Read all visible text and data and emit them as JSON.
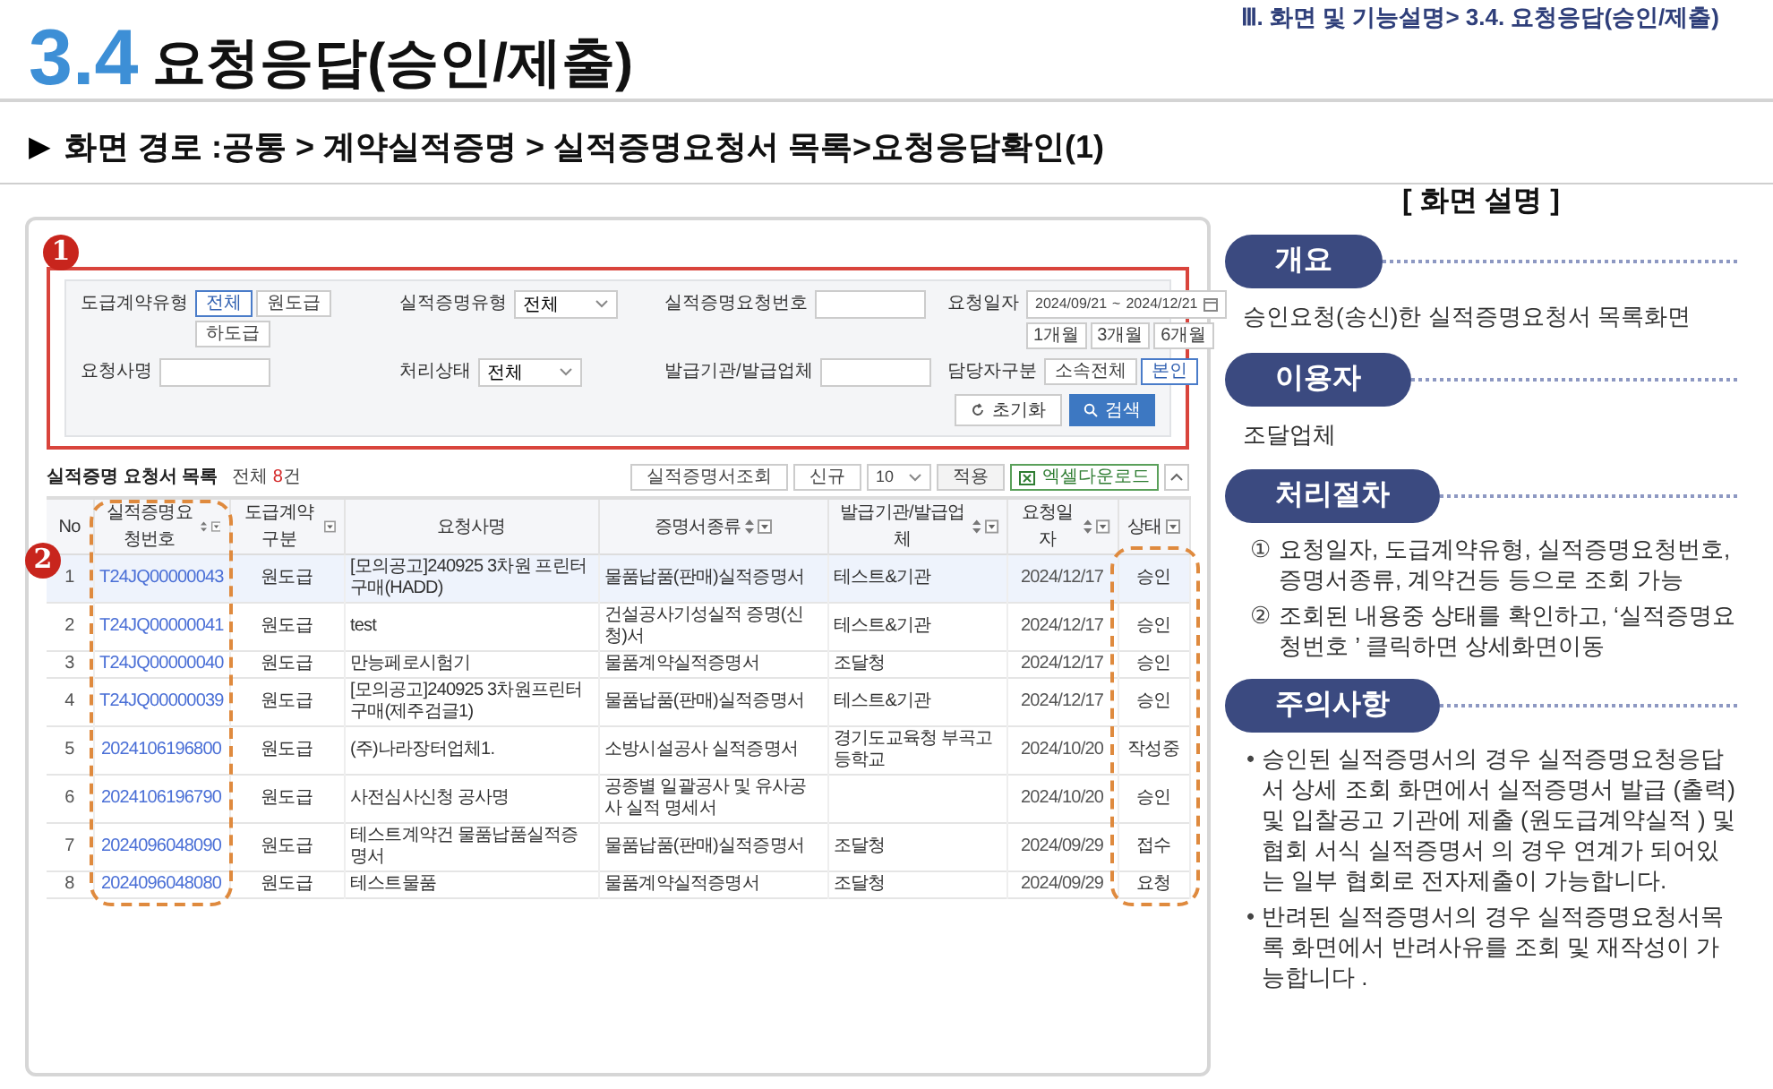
{
  "header": {
    "section_number": "3.4",
    "title": "요청응답(승인/제출)",
    "breadcrumb": "Ⅲ. 화면 및 기능설명> 3.4. 요청응답(승인/제출)"
  },
  "screen_path": {
    "marker": "▶",
    "text": "**화면 경로 :**공통 > 계약실적증명 > 실적증명요청서 목록>요청응답확인(1)"
  },
  "screen": {
    "callouts": [
      "1",
      "2"
    ],
    "filters": [
      {
        "kind": "toggle",
        "label": "도급계약유형",
        "options": [
          {
            "label": "전체",
            "selected": true
          },
          {
            "label": "원도급",
            "selected": false
          },
          {
            "label": "하도급",
            "selected": false
          }
        ]
      },
      {
        "kind": "select",
        "label": "실적증명유형",
        "value": "전체"
      },
      {
        "kind": "input",
        "label": "실적증명요청번호"
      },
      {
        "kind": "date_range",
        "label": "요청일자",
        "from": "2024/09/21",
        "separator": "~",
        "to": "2024/12/21",
        "presets": [
          "1개월",
          "3개월",
          "6개월"
        ]
      },
      {
        "kind": "input",
        "label": "요청사명"
      },
      {
        "kind": "select",
        "label": "처리상태",
        "value": "전체"
      },
      {
        "kind": "input",
        "label": "발급기관/발급업체"
      },
      {
        "kind": "toggle",
        "label": "담당자구분",
        "options": [
          {
            "label": "소속전체",
            "selected": false
          },
          {
            "label": "본인",
            "selected": true
          }
        ]
      }
    ],
    "filter_buttons": [
      {
        "kind": "reset",
        "label": "초기화"
      },
      {
        "kind": "search",
        "label": "검색"
      }
    ],
    "list": {
      "title": "실적증명 요청서 목록",
      "total_prefix": "전체 ",
      "total_count": "8",
      "total_suffix": "건",
      "toolbar": {
        "view_button": "실적증명서조회",
        "new_button": "신규",
        "page_size": "10",
        "apply_button": "적용",
        "excel_button": "엑셀다운로드"
      },
      "columns": [
        {
          "label": "No",
          "sortable": false,
          "filterable": false
        },
        {
          "label": "실적증명요청번호",
          "sortable": true,
          "filterable": true
        },
        {
          "label": "도급계약구분",
          "sortable": false,
          "filterable": true
        },
        {
          "label": "요청사명",
          "sortable": false,
          "filterable": false
        },
        {
          "label": "증명서종류",
          "sortable": true,
          "filterable": true
        },
        {
          "label": "발급기관/발급업체",
          "sortable": true,
          "filterable": true
        },
        {
          "label": "요청일자",
          "sortable": true,
          "filterable": true
        },
        {
          "label": "상태",
          "sortable": false,
          "filterable": true
        }
      ],
      "rows": [
        {
          "selected": true,
          "cells": [
            "1",
            "T24JQ00000043",
            "원도급",
            "[모의공고]240925 3차원 프린터 구매(HADD)",
            "물품납품(판매)실적증명서",
            "테스트&기관",
            "2024/12/17",
            "승인"
          ]
        },
        {
          "selected": false,
          "cells": [
            "2",
            "T24JQ00000041",
            "원도급",
            "test",
            "건설공사기성실적 증명(신청)서",
            "테스트&기관",
            "2024/12/17",
            "승인"
          ]
        },
        {
          "selected": false,
          "cells": [
            "3",
            "T24JQ00000040",
            "원도급",
            "만능페로시험기",
            "물품계약실적증명서",
            "조달청",
            "2024/12/17",
            "승인"
          ]
        },
        {
          "selected": false,
          "cells": [
            "4",
            "T24JQ00000039",
            "원도급",
            "[모의공고]240925 3차원프린터 구매(제주검글1)",
            "물품납품(판매)실적증명서",
            "테스트&기관",
            "2024/12/17",
            "승인"
          ]
        },
        {
          "selected": false,
          "cells": [
            "5",
            "2024106196800",
            "원도급",
            "(주)나라장터업체1.",
            "소방시설공사 실적증명서",
            "경기도교육청 부곡고등학교",
            "2024/10/20",
            "작성중"
          ]
        },
        {
          "selected": false,
          "cells": [
            "6",
            "2024106196790",
            "원도급",
            "사전심사신청 공사명",
            "공종별 일괄공사 및 유사공사 실적 명세서",
            null,
            "2024/10/20",
            "승인"
          ]
        },
        {
          "selected": false,
          "cells": [
            "7",
            "2024096048090",
            "원도급",
            "테스트계약건 물품납품실적증명서",
            "물품납품(판매)실적증명서",
            "조달청",
            "2024/09/29",
            "접수"
          ]
        },
        {
          "selected": false,
          "cells": [
            "8",
            "2024096048080",
            "원도급",
            "테스트물품",
            "물품계약실적증명서",
            "조달청",
            "2024/09/29",
            "요청"
          ]
        }
      ]
    }
  },
  "description": {
    "title": "[ 화면 설명 ]",
    "sections": [
      {
        "heading": "개요",
        "kind": "text",
        "text": "승인요청(송신)한 실적증명요청서 목록화면"
      },
      {
        "heading": "이용자",
        "kind": "text",
        "text": "조달업체"
      },
      {
        "heading": "처리절차",
        "kind": "numbered",
        "items": [
          {
            "marker": "①",
            "text": "요청일자, 도급계약유형, 실적증명요청번호, 증명서종류, 계약건등 등으로 조회 가능"
          },
          {
            "marker": "②",
            "text": "조회된 내용중 상태를 확인하고, ‘실적증명요청번호 ’ 클릭하면 상세화면이동"
          }
        ]
      },
      {
        "heading": "주의사항",
        "kind": "bullets",
        "items": [
          {
            "marker": "•",
            "text": "승인된 실적증명서의 경우 실적증명요청응답서 상세 조회 화면에서 실적증명서 발급 (출력) 및 입찰공고 기관에 제출 (원도급계약실적 ) 및 협회 서식 실적증명서 의 경우 연계가 되어있는 일부 협회로 전자제출이 가능합니다."
          },
          {
            "marker": "•",
            "text": "반려된 실적증명서의 경우 실적증명요청서목록 화면에서 반려사유를 조회 및 재작성이 가능합니다 ."
          }
        ]
      }
    ]
  }
}
